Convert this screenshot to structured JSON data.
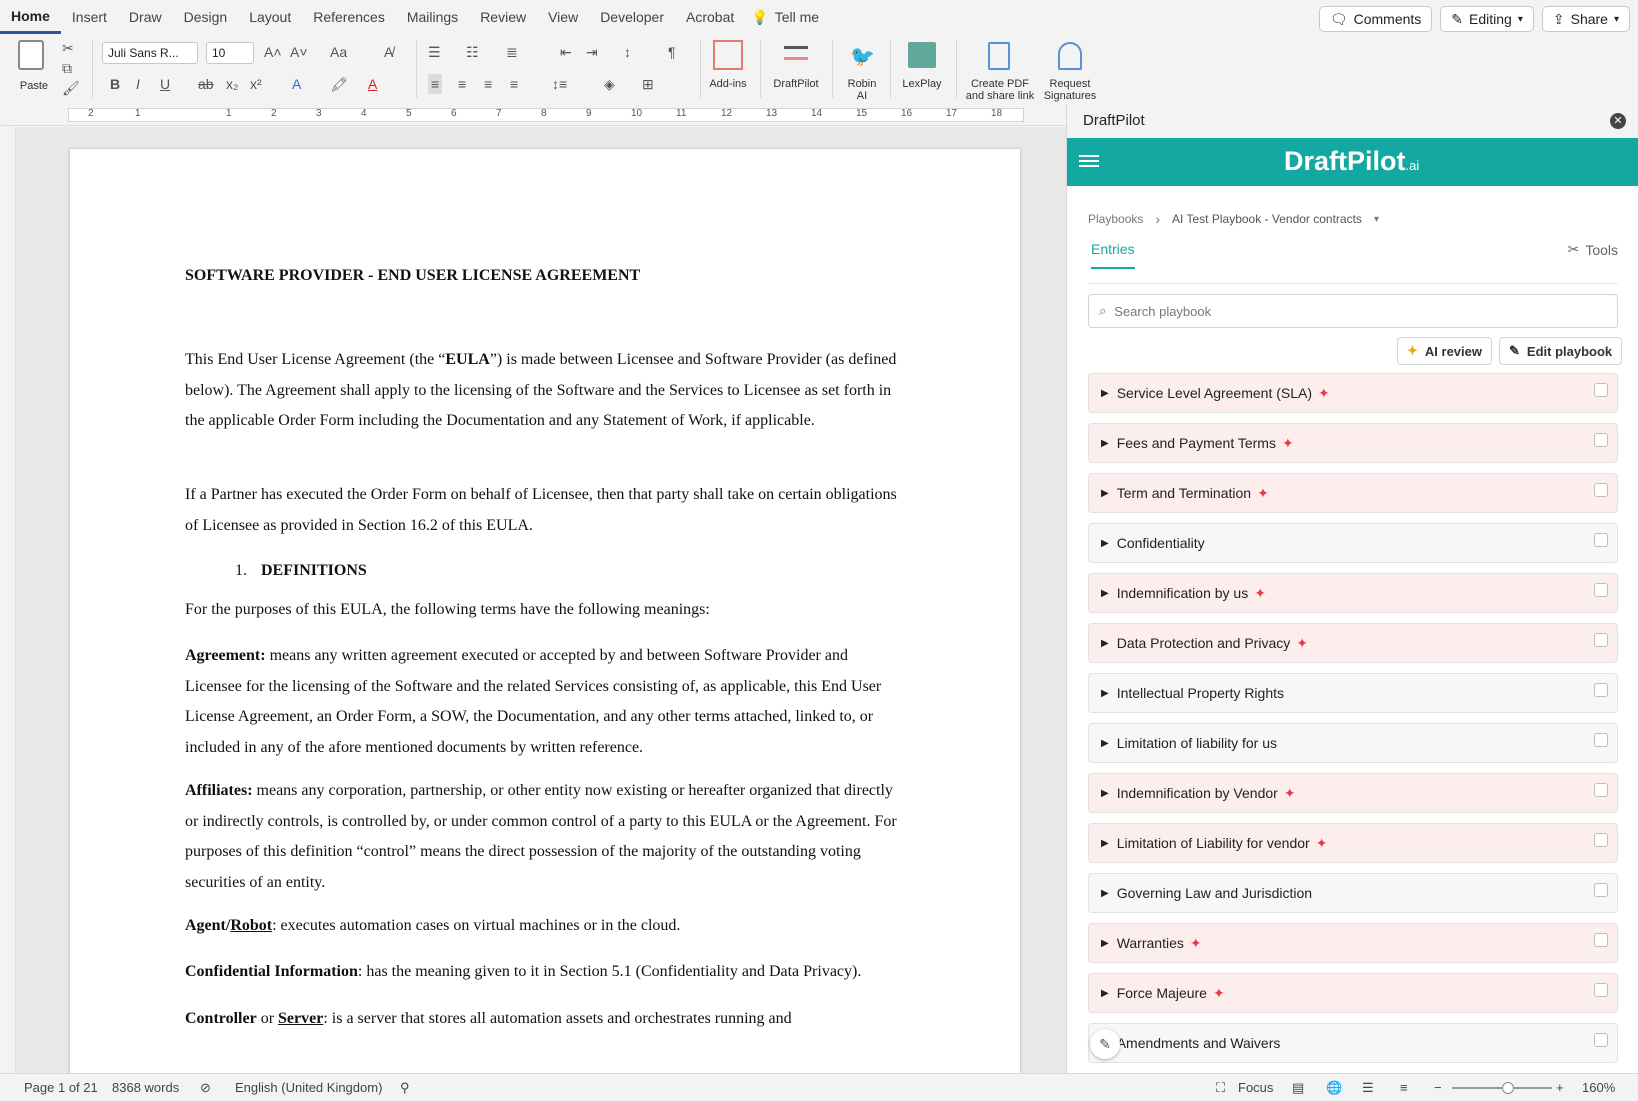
{
  "menu": {
    "tabs": [
      "Home",
      "Insert",
      "Draw",
      "Design",
      "Layout",
      "References",
      "Mailings",
      "Review",
      "View",
      "Developer",
      "Acrobat"
    ],
    "tell_me": "Tell me",
    "comments": "Comments",
    "editing": "Editing",
    "share": "Share"
  },
  "ribbon": {
    "paste": "Paste",
    "font_name": "Juli Sans R...",
    "font_size": "10",
    "addins": "Add-ins",
    "draftpilot": "DraftPilot",
    "robin1": "Robin",
    "robin2": "AI",
    "lexplay": "LexPlay",
    "createpdf1": "Create PDF",
    "createpdf2": "and share link",
    "request1": "Request",
    "request2": "Signatures"
  },
  "ruler": [
    "2",
    "1",
    "1",
    "2",
    "3",
    "4",
    "5",
    "6",
    "7",
    "8",
    "9",
    "10",
    "11",
    "12",
    "13",
    "14",
    "15",
    "16",
    "17",
    "18"
  ],
  "document": {
    "title": "SOFTWARE PROVIDER - END USER LICENSE AGREEMENT",
    "p1a": "This End User License Agreement (the “",
    "p1b": "EULA",
    "p1c": "”) is made between Licensee and Software Provider (as defined below). The Agreement shall apply to the licensing of the Software and the Services to Licensee as set forth in the applicable Order Form including the Documentation and any Statement of Work, if applicable.",
    "p2": "If a Partner has executed the Order Form on behalf of Licensee, then that party shall take on certain obligations of Licensee as provided in Section 16.2 of this EULA.",
    "h1_num": "1.",
    "h1": "DEFINITIONS",
    "p3": "For the purposes of this EULA, the following terms have the following meanings:",
    "agreement_term": "Agreement:",
    "agreement_def": " means any written agreement executed or accepted by and between Software Provider and Licensee for the licensing of the Software and the related Services consisting of, as applicable, this End User License Agreement, an Order Form, a SOW, the Documentation, and any other terms attached, linked to, or included in any of the afore mentioned documents by written reference.",
    "affiliates_term": "Affiliates:",
    "affiliates_def": " means any corporation, partnership, or other entity now existing or hereafter organized that directly or indirectly controls, is controlled by, or under common control of a party to this EULA or the Agreement. For purposes of this definition “control” means the direct possession of the majority of the outstanding voting securities of an entity.",
    "agent_term": "Agent/",
    "robot_term": "Robot",
    "agent_def": ": executes automation cases on virtual machines or in the cloud.",
    "conf_term": "Confidential Information",
    "conf_def": ": has the meaning given to it in Section 5.1 (Confidentiality and Data Privacy).",
    "ctrl_term": "Controller",
    "ctrl_or": " or ",
    "server_term": "Server",
    "ctrl_def": ": is a server that stores all automation assets and orchestrates running and"
  },
  "status": {
    "page": "Page 1 of 21",
    "words": "8368 words",
    "language": "English (United Kingdom)",
    "focus": "Focus",
    "zoom": "160%"
  },
  "panel": {
    "title": "DraftPilot",
    "brand": "DraftPilot",
    "brand_suffix": ".ai",
    "crumb_root": "Playbooks",
    "crumb_current": "AI Test Playbook - Vendor contracts",
    "tab_entries": "Entries",
    "tab_tools": "Tools",
    "search_placeholder": "Search playbook",
    "ai_review": "AI review",
    "edit_playbook": "Edit playbook",
    "entries": [
      {
        "label": "Service Level Agreement (SLA)",
        "ai": true
      },
      {
        "label": "Fees and Payment Terms",
        "ai": true
      },
      {
        "label": "Term and Termination",
        "ai": true
      },
      {
        "label": "Confidentiality",
        "ai": false
      },
      {
        "label": "Indemnification by us",
        "ai": true
      },
      {
        "label": "Data Protection and Privacy",
        "ai": true
      },
      {
        "label": "Intellectual Property Rights",
        "ai": false
      },
      {
        "label": "Limitation of liability for us",
        "ai": false
      },
      {
        "label": "Indemnification by Vendor",
        "ai": true
      },
      {
        "label": "Limitation of Liability for vendor",
        "ai": true
      },
      {
        "label": "Governing Law and Jurisdiction",
        "ai": false
      },
      {
        "label": "Warranties",
        "ai": true
      },
      {
        "label": "Force Majeure",
        "ai": true
      },
      {
        "label": "Amendments and Waivers",
        "ai": false
      }
    ]
  },
  "colors": {
    "brand_teal": "#13a8a2",
    "flag_bg": "#fdeeee",
    "spark": "#e8394a",
    "word_blue": "#2b579a"
  }
}
